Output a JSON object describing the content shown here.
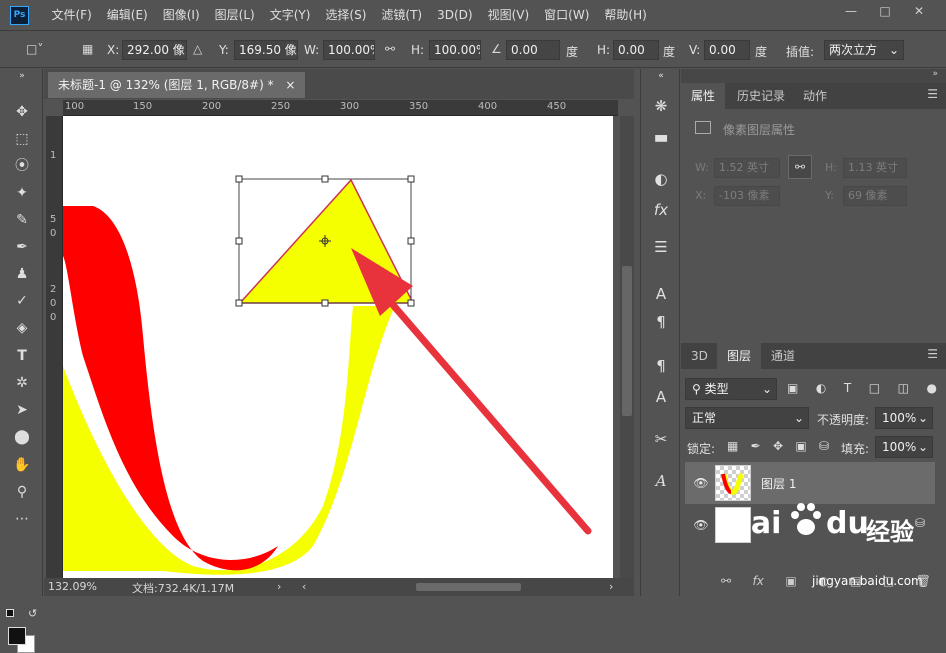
{
  "app": {
    "logo": "Ps",
    "menu": [
      "文件(F)",
      "编辑(E)",
      "图像(I)",
      "图层(L)",
      "文字(Y)",
      "选择(S)",
      "滤镜(T)",
      "3D(D)",
      "视图(V)",
      "窗口(W)",
      "帮助(H)"
    ]
  },
  "options": {
    "x_label": "X:",
    "x_value": "292.00 像",
    "y_label": "Y:",
    "y_value": "169.50 像",
    "w_label": "W:",
    "w_value": "100.00%",
    "h_label": "H:",
    "h_value": "100.00%",
    "angle_value": "0.00",
    "angle_unit": "度",
    "hskew_label": "H:",
    "hskew_value": "0.00",
    "hskew_unit": "度",
    "vskew_label": "V:",
    "vskew_value": "0.00",
    "vskew_unit": "度",
    "interp_label": "插值:",
    "interp_value": "两次立方"
  },
  "document": {
    "tab_title": "未标题-1 @ 132% (图层 1, RGB/8#) *",
    "close_glyph": "×",
    "ruler_h": [
      "100",
      "150",
      "200",
      "250",
      "300",
      "350",
      "400",
      "450"
    ],
    "ruler_v": [
      "1",
      "5",
      "0",
      "2",
      "0",
      "0"
    ],
    "zoom": "132.09%",
    "doc_info": "文档:732.4K/1.17M"
  },
  "properties_panel": {
    "tabs": [
      "属性",
      "历史记录",
      "动作"
    ],
    "subtitle": "像素图层属性",
    "w_label": "W:",
    "w_value": "1.52 英寸",
    "h_label": "H:",
    "h_value": "1.13 英寸",
    "x_label": "X:",
    "x_value": "-103 像素",
    "y_label": "Y:",
    "y_value": "69 像素"
  },
  "layers_panel": {
    "tabs": [
      "3D",
      "图层",
      "通道"
    ],
    "filter_label": "类型",
    "blend_mode": "正常",
    "opacity_label": "不透明度:",
    "opacity_value": "100%",
    "lock_label": "锁定:",
    "fill_label": "填充:",
    "fill_value": "100%",
    "layers": [
      {
        "name": "图层 1"
      },
      {
        "name": ""
      }
    ]
  },
  "watermark": {
    "text1": "Bai",
    "text2": "du",
    "text3": "经验",
    "url": "jingyan.baidu.com"
  },
  "colors": {
    "red_band": "#ff0000",
    "yellow_band": "#f5ff00",
    "arrow": "#e8323c",
    "ui_bg": "#535353"
  }
}
